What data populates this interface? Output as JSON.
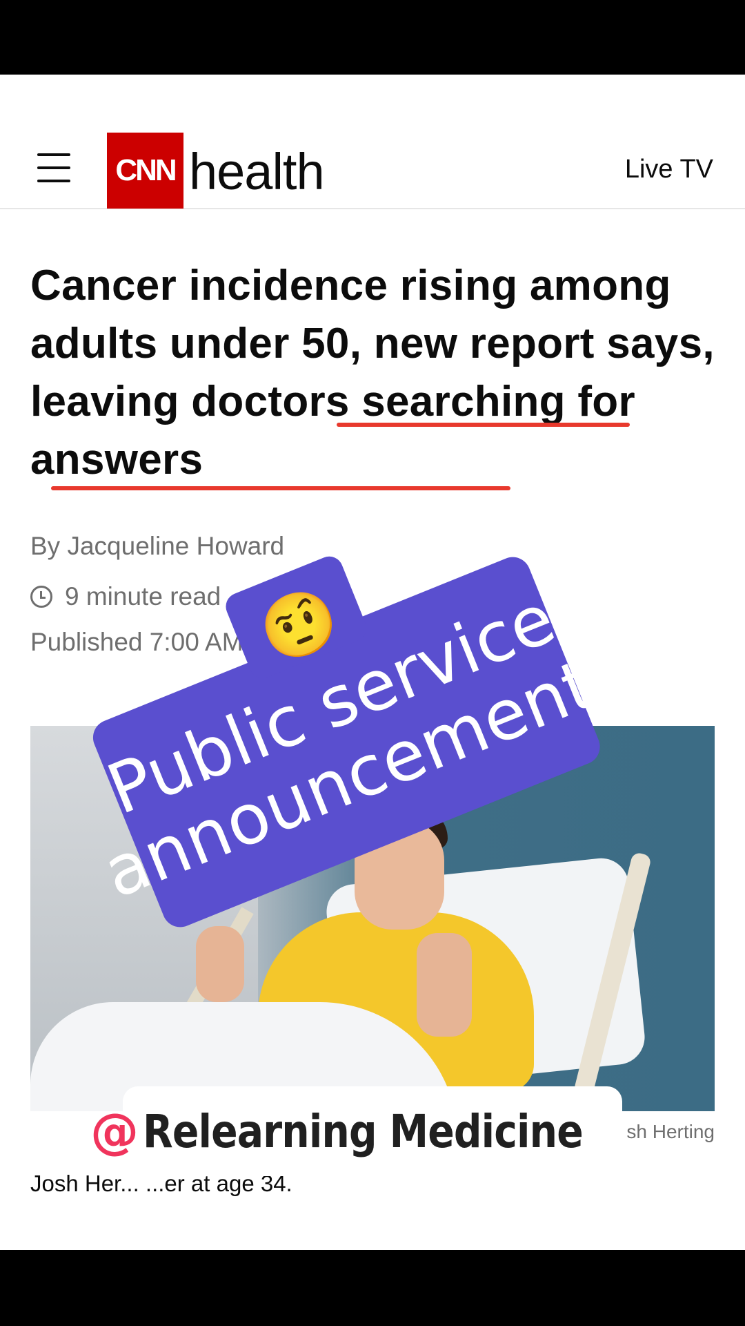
{
  "header": {
    "logo_text": "CNN",
    "section": "health",
    "live_tv": "Live TV",
    "menu_icon": "hamburger-menu-icon"
  },
  "article": {
    "headline": "Cancer incidence rising among adults under 50, new report says, leaving doctors searching for answers",
    "byline": "By Jacqueline Howard",
    "read_time": "9 minute read",
    "published": "Published 7:00 AM E",
    "photo_credit": "sh Herting",
    "caption": "Josh Her... ...er at age 34."
  },
  "overlay": {
    "emoji": "🤨",
    "psa_line1": "Public service",
    "psa_line2": "announcement:",
    "handle_symbol": "@",
    "handle": "Relearning Medicine"
  },
  "colors": {
    "cnn_red": "#cc0000",
    "psa_purple": "#5a4fcf",
    "underline_red": "#e8392d",
    "handle_pink": "#f0345c"
  }
}
